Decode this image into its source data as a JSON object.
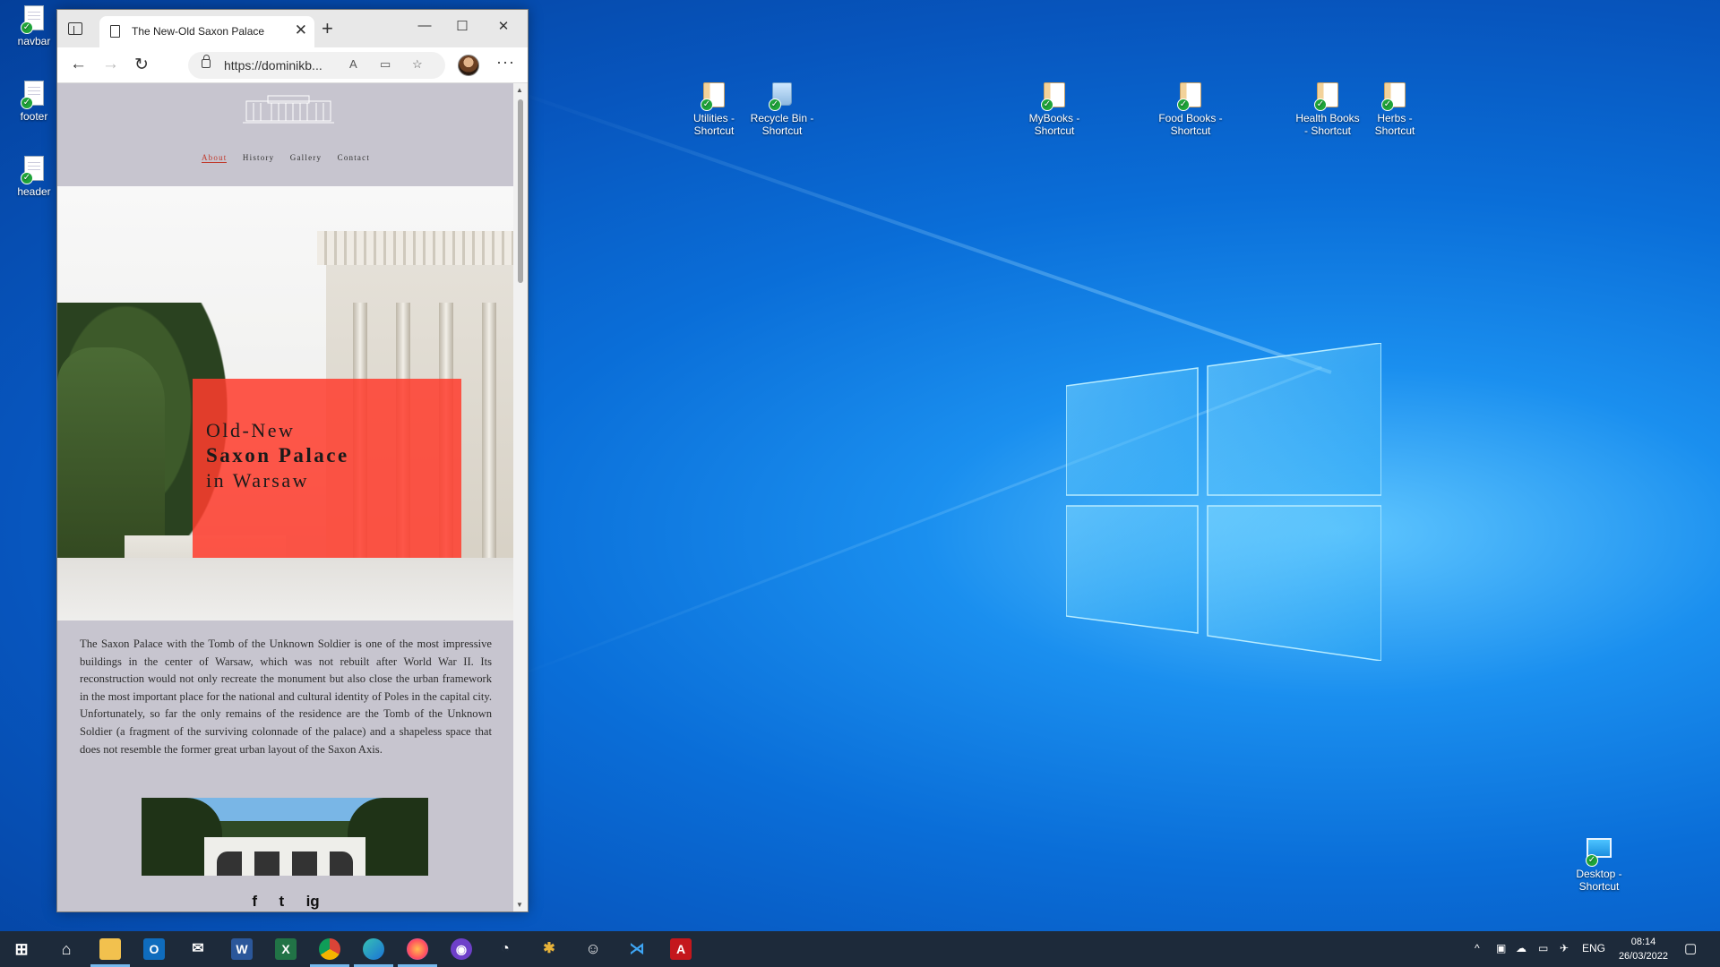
{
  "desktop": {
    "left_icons": [
      {
        "label": "navbar"
      },
      {
        "label": "footer"
      },
      {
        "label": "header"
      }
    ],
    "top_icons": [
      {
        "line1": "Utilities -",
        "line2": "Shortcut"
      },
      {
        "line1": "Recycle Bin -",
        "line2": "Shortcut"
      },
      {
        "line1": "MyBooks -",
        "line2": "Shortcut"
      },
      {
        "line1": "Food Books -",
        "line2": "Shortcut"
      },
      {
        "line1": "Health Books",
        "line2": "- Shortcut"
      },
      {
        "line1": "Herbs -",
        "line2": "Shortcut"
      }
    ],
    "bottom_right_icon": {
      "line1": "Desktop -",
      "line2": "Shortcut"
    }
  },
  "browser": {
    "tab_title": "The New-Old Saxon Palace",
    "url": "https://dominikb...",
    "new_tab": "+",
    "tab_close": "✕",
    "minimize": "—",
    "maximize": "☐",
    "close": "✕"
  },
  "site": {
    "nav": [
      "About",
      "History",
      "Gallery",
      "Contact"
    ],
    "hero_line1": "Old-New",
    "hero_line2": "Saxon Palace",
    "hero_line3": "in Warsaw",
    "article": "The Saxon Palace with the Tomb of the Unknown Soldier is one of the most impressive buildings in the center of Warsaw, which was not rebuilt after World War II. Its reconstruction would not only recreate the monument but also close the urban framework in the most important place for the national and cultural identity of Poles in the capital city. Unfortunately, so far the only remains of the residence are the Tomb of the Unknown Soldier (a fragment of the surviving colonnade of the palace) and a shapeless space that does not resemble the former great urban layout of the Saxon Axis.",
    "social": [
      "f",
      "t",
      "ig"
    ]
  },
  "taskbar": {
    "language": "ENG",
    "time": "08:14",
    "date": "26/03/2022"
  },
  "colors": {
    "hero_box": "#ff3c2d",
    "page_bg": "#c7c5cf",
    "taskbar": "#1d2a3a",
    "nav_active": "#c0392b"
  }
}
